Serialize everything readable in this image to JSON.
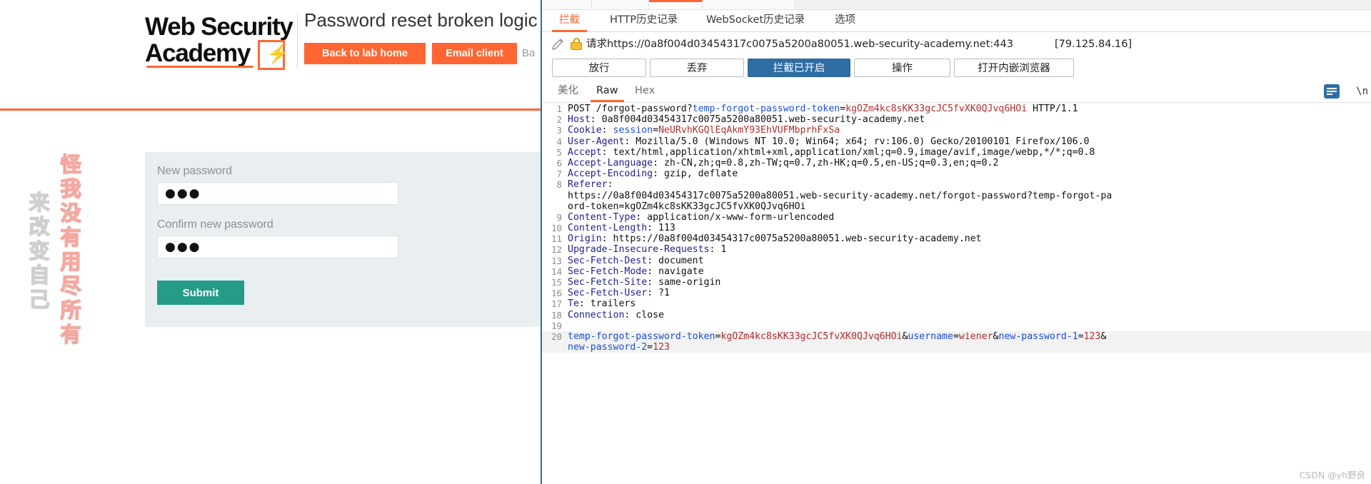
{
  "lab": {
    "logo_line1": "Web Security",
    "logo_line2": "Academy",
    "logo_bolt": "⚡",
    "title": "Password reset broken logic",
    "back_button": "Back to lab home",
    "email_button": "Email client",
    "trailing_text": "Ba",
    "watermark_red": "怪我没有用尽所有",
    "watermark_gray": "来改变自己",
    "form": {
      "new_password_label": "New password",
      "new_password_value": "●●●",
      "confirm_password_label": "Confirm new password",
      "confirm_password_value": "●●●",
      "submit_label": "Submit"
    }
  },
  "burp": {
    "tabs": [
      {
        "label": "拦截",
        "active": true
      },
      {
        "label": "HTTP历史记录",
        "active": false
      },
      {
        "label": "WebSocket历史记录",
        "active": false
      },
      {
        "label": "选项",
        "active": false
      }
    ],
    "url_prefix": "请求https://0a8f004d03454317c0075a5200a80051.web-security-academy.net:443",
    "url_ip": "[79.125.84.16]",
    "buttons": [
      {
        "label": "放行",
        "primary": false
      },
      {
        "label": "丢弃",
        "primary": false
      },
      {
        "label": "拦截已开启",
        "primary": true
      },
      {
        "label": "操作",
        "primary": false
      },
      {
        "label": "打开内嵌浏览器",
        "primary": false
      }
    ],
    "sub_tabs": [
      {
        "label": "美化",
        "active": false
      },
      {
        "label": "Raw",
        "active": true
      },
      {
        "label": "Hex",
        "active": false
      }
    ],
    "newline_label": "\\n",
    "request_lines": [
      {
        "n": "1",
        "parts": [
          {
            "t": "POST /forgot-password?",
            "c": "plain"
          },
          {
            "t": "temp-forgot-password-token",
            "c": "blue"
          },
          {
            "t": "=",
            "c": "plain"
          },
          {
            "t": "kgOZm4kc8sKK33gcJC5fvXK0QJvq6HOi",
            "c": "red"
          },
          {
            "t": " HTTP/1.1",
            "c": "plain"
          }
        ]
      },
      {
        "n": "2",
        "parts": [
          {
            "t": "Host",
            "c": "key"
          },
          {
            "t": ": 0a8f004d03454317c0075a5200a80051.web-security-academy.net",
            "c": "plain"
          }
        ]
      },
      {
        "n": "3",
        "parts": [
          {
            "t": "Cookie",
            "c": "key"
          },
          {
            "t": ": ",
            "c": "plain"
          },
          {
            "t": "session",
            "c": "blue"
          },
          {
            "t": "=",
            "c": "plain"
          },
          {
            "t": "NeURvhKGQlEqAkmY93EhVUFMbprhFxSa",
            "c": "red"
          }
        ]
      },
      {
        "n": "4",
        "parts": [
          {
            "t": "User-Agent",
            "c": "key"
          },
          {
            "t": ": Mozilla/5.0 (Windows NT 10.0; Win64; x64; rv:106.0) Gecko/20100101 Firefox/106.0",
            "c": "plain"
          }
        ]
      },
      {
        "n": "5",
        "parts": [
          {
            "t": "Accept",
            "c": "key"
          },
          {
            "t": ": text/html,application/xhtml+xml,application/xml;q=0.9,image/avif,image/webp,*/*;q=0.8",
            "c": "plain"
          }
        ]
      },
      {
        "n": "6",
        "parts": [
          {
            "t": "Accept-Language",
            "c": "key"
          },
          {
            "t": ": zh-CN,zh;q=0.8,zh-TW;q=0.7,zh-HK;q=0.5,en-US;q=0.3,en;q=0.2",
            "c": "plain"
          }
        ]
      },
      {
        "n": "7",
        "parts": [
          {
            "t": "Accept-Encoding",
            "c": "key"
          },
          {
            "t": ": gzip, deflate",
            "c": "plain"
          }
        ]
      },
      {
        "n": "8",
        "parts": [
          {
            "t": "Referer",
            "c": "key"
          },
          {
            "t": ":",
            "c": "plain"
          }
        ]
      },
      {
        "n": "",
        "parts": [
          {
            "t": "https://0a8f004d03454317c0075a5200a80051.web-security-academy.net/forgot-password?temp-forgot-pa",
            "c": "plain"
          }
        ]
      },
      {
        "n": "",
        "parts": [
          {
            "t": "ord-token=kgOZm4kc8sKK33gcJC5fvXK0QJvq6HOi",
            "c": "plain"
          }
        ]
      },
      {
        "n": "9",
        "parts": [
          {
            "t": "Content-Type",
            "c": "key"
          },
          {
            "t": ": application/x-www-form-urlencoded",
            "c": "plain"
          }
        ]
      },
      {
        "n": "10",
        "parts": [
          {
            "t": "Content-Length",
            "c": "key"
          },
          {
            "t": ": 113",
            "c": "plain"
          }
        ]
      },
      {
        "n": "11",
        "parts": [
          {
            "t": "Origin",
            "c": "key"
          },
          {
            "t": ": https://0a8f004d03454317c0075a5200a80051.web-security-academy.net",
            "c": "plain"
          }
        ]
      },
      {
        "n": "12",
        "parts": [
          {
            "t": "Upgrade-Insecure-Requests",
            "c": "key"
          },
          {
            "t": ": 1",
            "c": "plain"
          }
        ]
      },
      {
        "n": "13",
        "parts": [
          {
            "t": "Sec-Fetch-Dest",
            "c": "key"
          },
          {
            "t": ": document",
            "c": "plain"
          }
        ]
      },
      {
        "n": "14",
        "parts": [
          {
            "t": "Sec-Fetch-Mode",
            "c": "key"
          },
          {
            "t": ": navigate",
            "c": "plain"
          }
        ]
      },
      {
        "n": "15",
        "parts": [
          {
            "t": "Sec-Fetch-Site",
            "c": "key"
          },
          {
            "t": ": same-origin",
            "c": "plain"
          }
        ]
      },
      {
        "n": "16",
        "parts": [
          {
            "t": "Sec-Fetch-User",
            "c": "key"
          },
          {
            "t": ": ?1",
            "c": "plain"
          }
        ]
      },
      {
        "n": "17",
        "parts": [
          {
            "t": "Te",
            "c": "key"
          },
          {
            "t": ": trailers",
            "c": "plain"
          }
        ]
      },
      {
        "n": "18",
        "parts": [
          {
            "t": "Connection",
            "c": "key"
          },
          {
            "t": ": close",
            "c": "plain"
          }
        ]
      },
      {
        "n": "19",
        "parts": [
          {
            "t": "",
            "c": "plain"
          }
        ]
      },
      {
        "n": "20",
        "body": true,
        "parts": [
          {
            "t": "temp-forgot-password-token",
            "c": "blue"
          },
          {
            "t": "=",
            "c": "plain"
          },
          {
            "t": "kgOZm4kc8sKK33gcJC5fvXK0QJvq6HOi",
            "c": "red"
          },
          {
            "t": "&",
            "c": "plain"
          },
          {
            "t": "username",
            "c": "blue"
          },
          {
            "t": "=",
            "c": "plain"
          },
          {
            "t": "wiener",
            "c": "red"
          },
          {
            "t": "&",
            "c": "plain"
          },
          {
            "t": "new-password-1",
            "c": "blue"
          },
          {
            "t": "=",
            "c": "plain"
          },
          {
            "t": "123",
            "c": "red"
          },
          {
            "t": "&",
            "c": "plain"
          }
        ]
      },
      {
        "n": "",
        "body": true,
        "parts": [
          {
            "t": "new-password-2",
            "c": "blue"
          },
          {
            "t": "=",
            "c": "plain"
          },
          {
            "t": "123",
            "c": "red"
          }
        ]
      }
    ]
  },
  "watermark": "CSDN @yh野良",
  "colors": {
    "accent_orange": "#ff6633",
    "burp_blue": "#2e6da4",
    "submit_green": "#249c87",
    "panel_gray": "#e9eef0"
  }
}
